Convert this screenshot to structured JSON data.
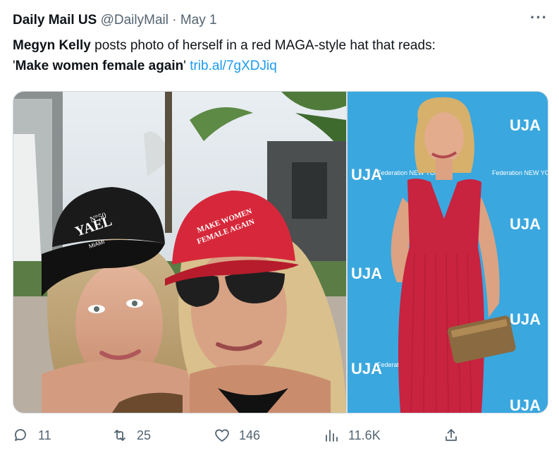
{
  "tweet": {
    "author_name": "Daily Mail US",
    "author_handle": "@DailyMail",
    "separator": "·",
    "date": "May 1",
    "more_label": "···",
    "text": {
      "bold_name": "Megyn Kelly",
      "body": " posts photo of herself in a red MAGA-style hat that reads:",
      "quote_open": "'",
      "bold_quote": "Make women female again",
      "quote_close": "' ",
      "link": "trib.al/7gXDJiq"
    },
    "images": {
      "left_cap_black": "YAEL",
      "left_cap_black_top": "N°50",
      "left_cap_black_bottom": "MIAMI",
      "left_cap_red_line1": "MAKE WOMEN",
      "left_cap_red_line2": "FEMALE AGAIN",
      "right_backdrop_logo": "UJA",
      "right_backdrop_sub": "Federation NEW YORK"
    },
    "actions": {
      "replies": "11",
      "reposts": "25",
      "likes": "146",
      "views": "11.6K"
    }
  }
}
